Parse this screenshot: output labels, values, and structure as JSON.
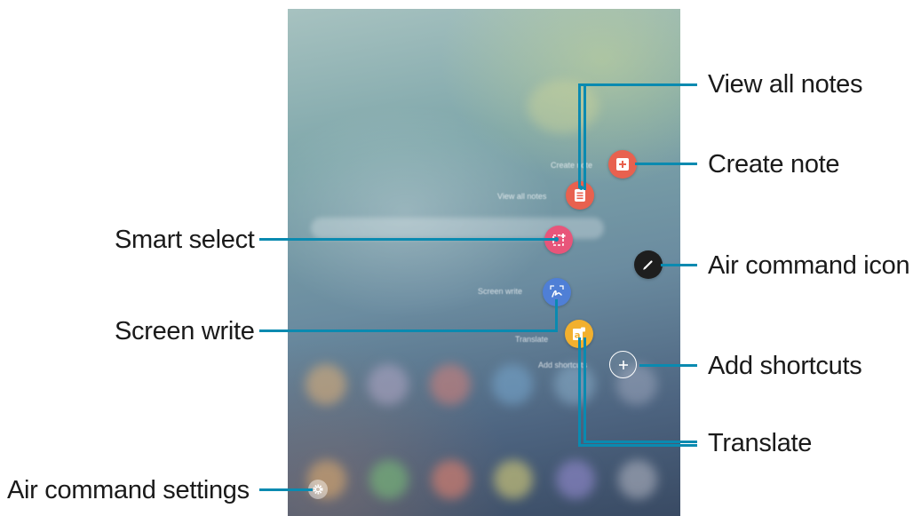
{
  "screen": {
    "ghost_labels": {
      "create_note": "Create note",
      "view_all_notes": "View all notes",
      "screen_write": "Screen write",
      "translate": "Translate",
      "add_shortcuts": "Add shortcuts"
    }
  },
  "callouts": {
    "view_all_notes": "View all notes",
    "create_note": "Create note",
    "smart_select": "Smart select",
    "air_command_icon": "Air command icon",
    "screen_write": "Screen write",
    "add_shortcuts": "Add shortcuts",
    "translate": "Translate",
    "air_command_settings": "Air command settings"
  },
  "icons": {
    "create_note": "note-add-icon",
    "view_all_notes": "notes-list-icon",
    "smart_select": "smart-select-icon",
    "screen_write": "screen-write-icon",
    "translate": "translate-icon",
    "air_command": "pen-icon",
    "add_shortcuts": "plus-icon",
    "settings": "gear-icon"
  },
  "colors": {
    "leader_line": "#0a8ab0",
    "create_note": "#e8614f",
    "view_all_notes": "#e8614f",
    "smart_select": "#e8557a",
    "screen_write": "#4f7fd6",
    "translate": "#f2b02e",
    "air_command": "#1e1e1e"
  }
}
